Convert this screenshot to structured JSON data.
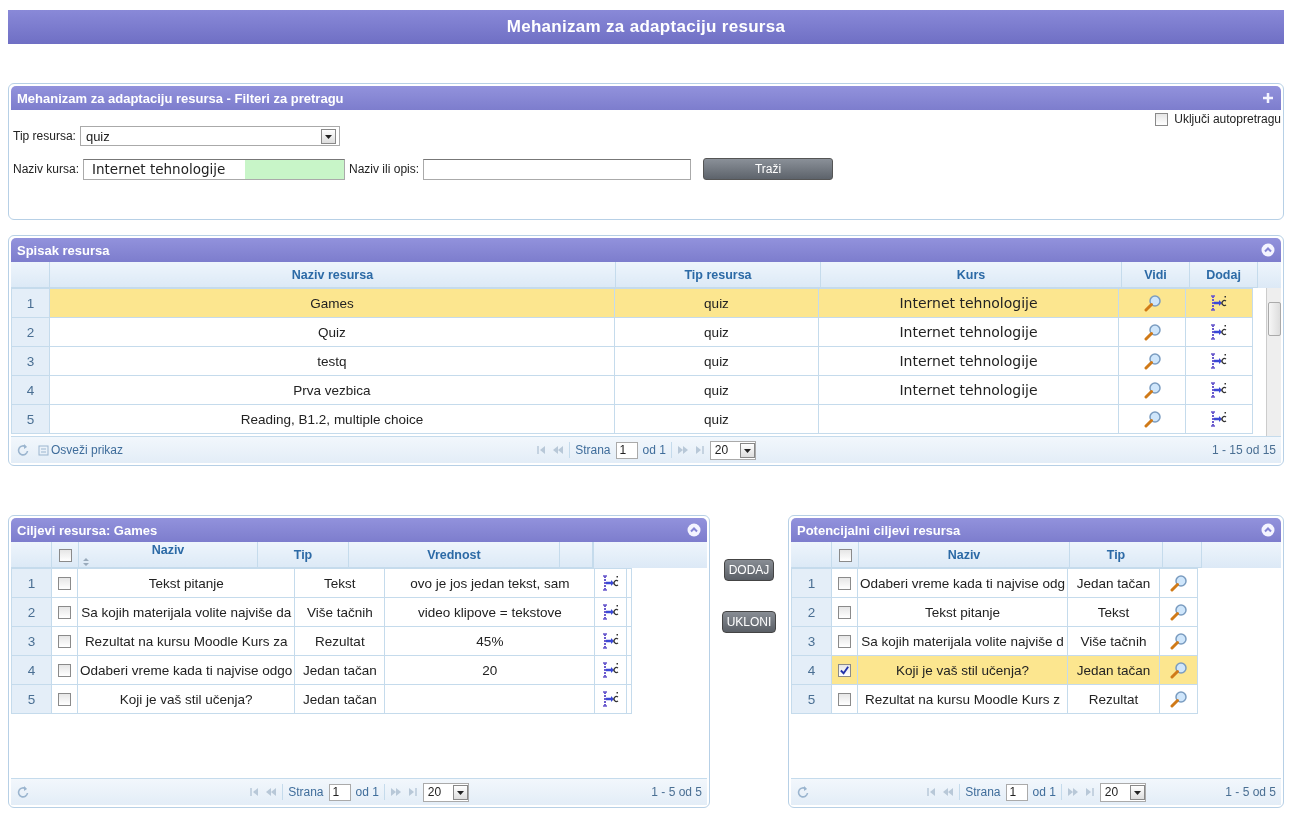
{
  "page_title": "Mehanizam za adaptaciju resursa",
  "filter_panel": {
    "title": "Mehanizam za adaptaciju resursa - Filteri za pretragu",
    "expanded": false,
    "autosearch": {
      "label": "Uključi autopretragu",
      "checked": false
    },
    "resource_type": {
      "label": "Tip resursa:",
      "value": "quiz"
    },
    "course_name": {
      "label": "Naziv kursa:",
      "value": "Internet tehnologije"
    },
    "name_or_description": {
      "label": "Naziv ili opis:"
    },
    "search_button": "Traži"
  },
  "resources_panel": {
    "title": "Spisak resursa",
    "expanded": true,
    "columns": [
      "Naziv resursa",
      "Tip resursa",
      "Kurs",
      "Vidi",
      "Dodaj"
    ],
    "rows": [
      {
        "number": "1",
        "name": "Games",
        "type": "quiz",
        "course": "Internet tehnologije",
        "selected": true
      },
      {
        "number": "2",
        "name": "Quiz",
        "type": "quiz",
        "course": "Internet tehnologije",
        "selected": false
      },
      {
        "number": "3",
        "name": "testq",
        "type": "quiz",
        "course": "Internet tehnologije",
        "selected": false
      },
      {
        "number": "4",
        "name": "Prva vezbica",
        "type": "quiz",
        "course": "Internet tehnologije",
        "selected": false
      },
      {
        "number": "5",
        "name": "Reading, B1.2, multiple choice",
        "type": "quiz",
        "course": "",
        "selected": false
      }
    ],
    "pager": {
      "refresh_label": "Osveži prikaz",
      "page_label": "Strana",
      "page": "1",
      "page_count": "od 1",
      "page_size": "20",
      "summary": "1 - 15 od 15"
    }
  },
  "goals_panel": {
    "title": "Ciljevi resursa: Games",
    "expanded": true,
    "all_checked": false,
    "columns": [
      "Naziv",
      "Tip",
      "Vrednost"
    ],
    "rows": [
      {
        "number": "1",
        "checked": false,
        "selected": false,
        "name": "Tekst pitanje",
        "type": "Tekst",
        "value": "ovo je jos jedan tekst, sam"
      },
      {
        "number": "2",
        "checked": false,
        "selected": false,
        "name": "Sa kojih materijala volite najviše da",
        "type": "Više tačnih",
        "value": "video klipove = tekstove"
      },
      {
        "number": "3",
        "checked": false,
        "selected": false,
        "name": "Rezultat na kursu Moodle Kurs za",
        "type": "Rezultat",
        "value": "45%"
      },
      {
        "number": "4",
        "checked": false,
        "selected": false,
        "name": "Odaberi vreme kada ti najvise odgo",
        "type": "Jedan tačan",
        "value": "20"
      },
      {
        "number": "5",
        "checked": false,
        "selected": false,
        "name": "Koji je vaš stil učenja?",
        "type": "Jedan tačan",
        "value": ""
      }
    ],
    "pager": {
      "page_label": "Strana",
      "page": "1",
      "page_count": "od 1",
      "page_size": "20",
      "summary": "1 - 5 od 5"
    }
  },
  "move_buttons": [
    "DODAJ",
    "UKLONI"
  ],
  "potential_panel": {
    "title": "Potencijalni ciljevi resursa",
    "expanded": true,
    "all_checked": false,
    "columns": [
      "Naziv",
      "Tip"
    ],
    "rows": [
      {
        "number": "1",
        "checked": false,
        "selected": false,
        "name": "Odaberi vreme kada ti najvise odg",
        "type": "Jedan tačan"
      },
      {
        "number": "2",
        "checked": false,
        "selected": false,
        "name": "Tekst pitanje",
        "type": "Tekst"
      },
      {
        "number": "3",
        "checked": false,
        "selected": false,
        "name": "Sa kojih materijala volite najviše d",
        "type": "Više tačnih"
      },
      {
        "number": "4",
        "checked": true,
        "selected": true,
        "name": "Koji je vaš stil učenja?",
        "type": "Jedan tačan"
      },
      {
        "number": "5",
        "checked": false,
        "selected": false,
        "name": "Rezultat na kursu Moodle Kurs z",
        "type": "Rezultat"
      }
    ],
    "pager": {
      "page_label": "Strana",
      "page": "1",
      "page_count": "od 1",
      "page_size": "20",
      "summary": "1 - 5 od 5"
    }
  }
}
